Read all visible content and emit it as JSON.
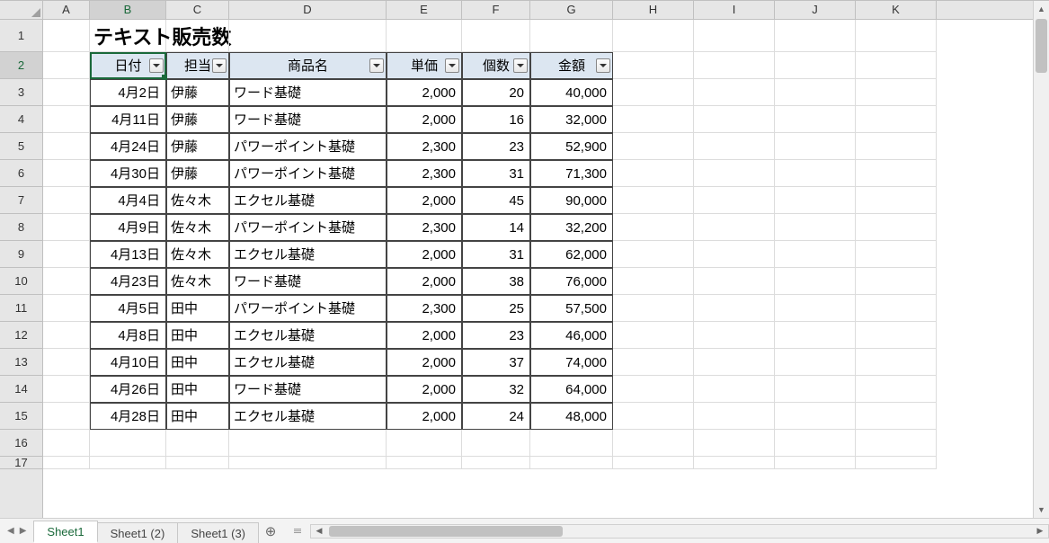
{
  "columns": [
    "A",
    "B",
    "C",
    "D",
    "E",
    "F",
    "G",
    "H",
    "I",
    "J",
    "K"
  ],
  "row_labels": [
    "1",
    "2",
    "3",
    "4",
    "5",
    "6",
    "7",
    "8",
    "9",
    "10",
    "11",
    "12",
    "13",
    "14",
    "15",
    "16",
    "17"
  ],
  "title": "テキスト販売数",
  "selected_col": "B",
  "selected_row": "2",
  "table_headers": {
    "b": "日付",
    "c": "担当",
    "d": "商品名",
    "e": "単価",
    "f": "個数",
    "g": "金額"
  },
  "rows": [
    {
      "b": "4月2日",
      "c": "伊藤",
      "d": "ワード基礎",
      "e": "2,000",
      "f": "20",
      "g": "40,000"
    },
    {
      "b": "4月11日",
      "c": "伊藤",
      "d": "ワード基礎",
      "e": "2,000",
      "f": "16",
      "g": "32,000"
    },
    {
      "b": "4月24日",
      "c": "伊藤",
      "d": "パワーポイント基礎",
      "e": "2,300",
      "f": "23",
      "g": "52,900"
    },
    {
      "b": "4月30日",
      "c": "伊藤",
      "d": "パワーポイント基礎",
      "e": "2,300",
      "f": "31",
      "g": "71,300"
    },
    {
      "b": "4月4日",
      "c": "佐々木",
      "d": "エクセル基礎",
      "e": "2,000",
      "f": "45",
      "g": "90,000"
    },
    {
      "b": "4月9日",
      "c": "佐々木",
      "d": "パワーポイント基礎",
      "e": "2,300",
      "f": "14",
      "g": "32,200"
    },
    {
      "b": "4月13日",
      "c": "佐々木",
      "d": "エクセル基礎",
      "e": "2,000",
      "f": "31",
      "g": "62,000"
    },
    {
      "b": "4月23日",
      "c": "佐々木",
      "d": "ワード基礎",
      "e": "2,000",
      "f": "38",
      "g": "76,000"
    },
    {
      "b": "4月5日",
      "c": "田中",
      "d": "パワーポイント基礎",
      "e": "2,300",
      "f": "25",
      "g": "57,500"
    },
    {
      "b": "4月8日",
      "c": "田中",
      "d": "エクセル基礎",
      "e": "2,000",
      "f": "23",
      "g": "46,000"
    },
    {
      "b": "4月10日",
      "c": "田中",
      "d": "エクセル基礎",
      "e": "2,000",
      "f": "37",
      "g": "74,000"
    },
    {
      "b": "4月26日",
      "c": "田中",
      "d": "ワード基礎",
      "e": "2,000",
      "f": "32",
      "g": "64,000"
    },
    {
      "b": "4月28日",
      "c": "田中",
      "d": "エクセル基礎",
      "e": "2,000",
      "f": "24",
      "g": "48,000"
    }
  ],
  "sheets": [
    {
      "name": "Sheet1",
      "active": true
    },
    {
      "name": "Sheet1 (2)",
      "active": false
    },
    {
      "name": "Sheet1 (3)",
      "active": false
    }
  ],
  "icons": {
    "plus": "⊕",
    "tri_left": "◀",
    "tri_right": "▶",
    "tri_up": "▲",
    "tri_down": "▼"
  },
  "chart_data": {
    "type": "table",
    "title": "テキスト販売数",
    "columns": [
      "日付",
      "担当",
      "商品名",
      "単価",
      "個数",
      "金額"
    ],
    "records": [
      [
        "4月2日",
        "伊藤",
        "ワード基礎",
        2000,
        20,
        40000
      ],
      [
        "4月11日",
        "伊藤",
        "ワード基礎",
        2000,
        16,
        32000
      ],
      [
        "4月24日",
        "伊藤",
        "パワーポイント基礎",
        2300,
        23,
        52900
      ],
      [
        "4月30日",
        "伊藤",
        "パワーポイント基礎",
        2300,
        31,
        71300
      ],
      [
        "4月4日",
        "佐々木",
        "エクセル基礎",
        2000,
        45,
        90000
      ],
      [
        "4月9日",
        "佐々木",
        "パワーポイント基礎",
        2300,
        14,
        32200
      ],
      [
        "4月13日",
        "佐々木",
        "エクセル基礎",
        2000,
        31,
        62000
      ],
      [
        "4月23日",
        "佐々木",
        "ワード基礎",
        2000,
        38,
        76000
      ],
      [
        "4月5日",
        "田中",
        "パワーポイント基礎",
        2300,
        25,
        57500
      ],
      [
        "4月8日",
        "田中",
        "エクセル基礎",
        2000,
        23,
        46000
      ],
      [
        "4月10日",
        "田中",
        "エクセル基礎",
        2000,
        37,
        74000
      ],
      [
        "4月26日",
        "田中",
        "ワード基礎",
        2000,
        32,
        64000
      ],
      [
        "4月28日",
        "田中",
        "エクセル基礎",
        2000,
        24,
        48000
      ]
    ]
  }
}
